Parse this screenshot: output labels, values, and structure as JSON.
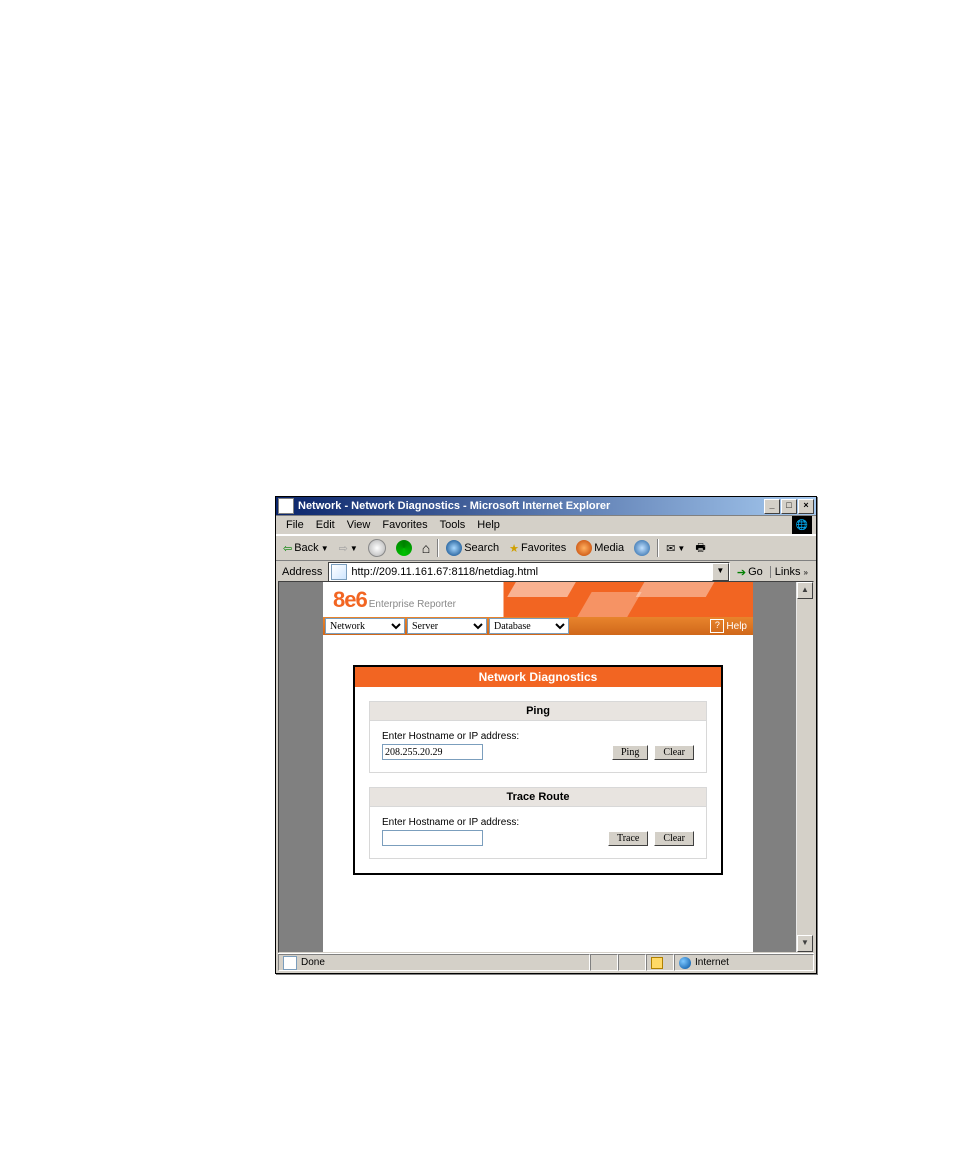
{
  "window": {
    "title": "Network - Network Diagnostics - Microsoft Internet Explorer"
  },
  "menubar": {
    "file": "File",
    "edit": "Edit",
    "view": "View",
    "favorites": "Favorites",
    "tools": "Tools",
    "help": "Help"
  },
  "toolbar": {
    "back": "Back",
    "search": "Search",
    "favorites": "Favorites",
    "media": "Media"
  },
  "addressbar": {
    "label": "Address",
    "url": "http://209.11.161.67:8118/netdiag.html",
    "go": "Go",
    "links": "Links"
  },
  "banner": {
    "logo": "8e6",
    "subtitle": "Enterprise Reporter"
  },
  "app_nav": {
    "network": "Network",
    "server": "Server",
    "database": "Database",
    "help": "Help"
  },
  "panel": {
    "title": "Network Diagnostics",
    "ping": {
      "heading": "Ping",
      "label": "Enter Hostname or IP address:",
      "value": "208.255.20.29",
      "btn_ping": "Ping",
      "btn_clear": "Clear"
    },
    "trace": {
      "heading": "Trace Route",
      "label": "Enter Hostname or IP address:",
      "value": "",
      "btn_trace": "Trace",
      "btn_clear": "Clear"
    }
  },
  "status": {
    "done": "Done",
    "zone": "Internet"
  }
}
